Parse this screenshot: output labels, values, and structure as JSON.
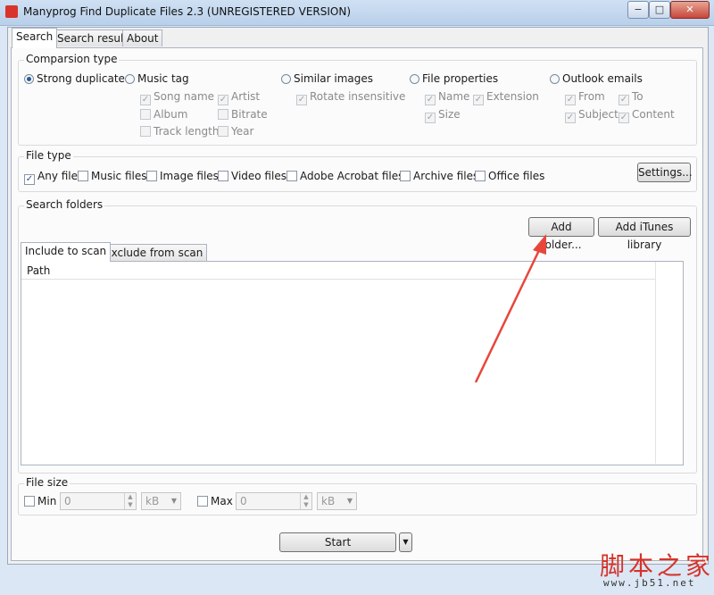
{
  "window": {
    "title": "Manyprog Find Duplicate Files 2.3 (UNREGISTERED VERSION)",
    "min_glyph": "−",
    "max_glyph": "□",
    "close_glyph": "✕"
  },
  "tabs": [
    "Search",
    "Search result",
    "About"
  ],
  "comparison": {
    "title": "Comparsion type",
    "strong": "Strong duplicate",
    "music_tag": "Music tag",
    "similar_images": "Similar images",
    "file_properties": "File properties",
    "outlook_emails": "Outlook emails",
    "music_options": {
      "song_name": "Song name",
      "artist": "Artist",
      "album": "Album",
      "bitrate": "Bitrate",
      "track_length": "Track length",
      "year": "Year"
    },
    "image_options": {
      "rotate": "Rotate insensitive"
    },
    "file_options": {
      "name": "Name",
      "extension": "Extension",
      "size": "Size"
    },
    "outlook_options": {
      "from": "From",
      "to": "To",
      "subject": "Subject",
      "content": "Content"
    }
  },
  "file_type": {
    "title": "File type",
    "any": "Any file",
    "music": "Music files",
    "image": "Image files",
    "video": "Video files",
    "acrobat": "Adobe Acrobat files",
    "archive": "Archive files",
    "office": "Office files",
    "settings_label": "Settings..."
  },
  "search_folders": {
    "title": "Search folders",
    "add_folder": "Add folder...",
    "add_itunes": "Add iTunes library",
    "include_tab": "Include to scan",
    "exclude_tab": "Exclude from scan",
    "column_path": "Path"
  },
  "file_size": {
    "title": "File size",
    "min_label": "Min",
    "max_label": "Max",
    "min_value": "0",
    "max_value": "0",
    "min_unit": "kB",
    "max_unit": "kB"
  },
  "start": {
    "label": "Start",
    "dropdown_glyph": "▼"
  },
  "watermark": {
    "text": "脚本之家",
    "url": "www.jb51.net"
  },
  "colors": {
    "arrow": "#e8463a",
    "watermark": "#d6332a"
  }
}
